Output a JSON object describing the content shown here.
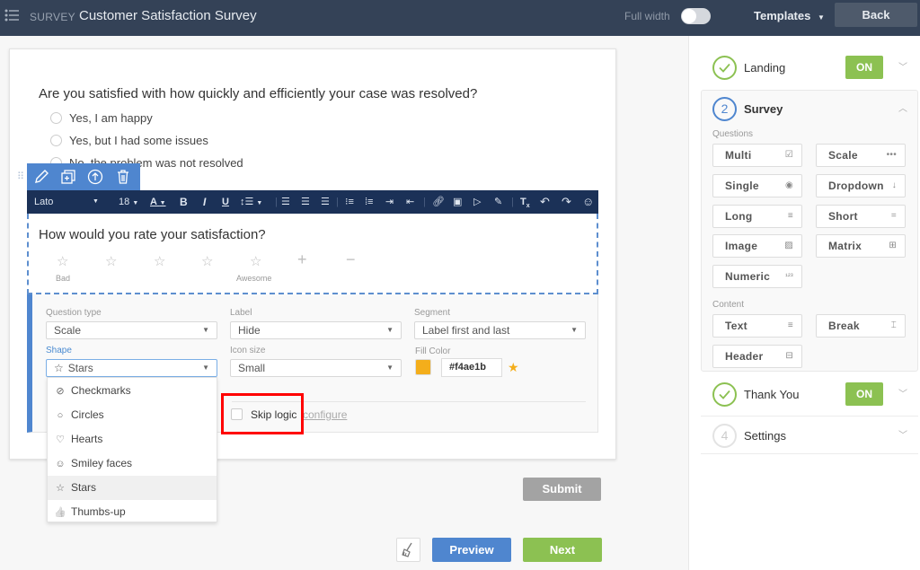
{
  "topbar": {
    "menu_icon": "list-menu-icon",
    "section": "SURVEY",
    "title": "Customer Satisfaction Survey",
    "full_width_label": "Full width",
    "full_width_on": false,
    "templates_label": "Templates",
    "back_label": "Back"
  },
  "question1": {
    "text": "Are you satisfied with how quickly and efficiently your case was resolved?",
    "options": [
      "Yes, I am happy",
      "Yes, but I had some issues",
      "No, the problem was not resolved"
    ]
  },
  "block_tools": [
    "edit-icon",
    "duplicate-icon",
    "move-up-icon",
    "delete-icon"
  ],
  "rich_text_toolbar": {
    "font": "Lato",
    "size": "18",
    "buttons": [
      "font-color",
      "bold",
      "italic",
      "underline",
      "line-height",
      "align-left",
      "align-center",
      "align-right",
      "bullet-list",
      "numbered-list",
      "indent",
      "outdent",
      "link",
      "image",
      "video",
      "clear-format-brush",
      "remove-format",
      "undo",
      "redo",
      "emoji"
    ]
  },
  "question2": {
    "text": "How would you rate your satisfaction?",
    "scale_count": 5,
    "label_first": "Bad",
    "label_last": "Awesome",
    "add_symbol": "+",
    "remove_symbol": "−"
  },
  "settings": {
    "question_type": {
      "label": "Question type",
      "value": "Scale"
    },
    "label": {
      "label": "Label",
      "value": "Hide"
    },
    "segment": {
      "label": "Segment",
      "value": "Label first and last"
    },
    "shape": {
      "label": "Shape",
      "value": "Stars",
      "icon": "☆"
    },
    "icon_size": {
      "label": "Icon size",
      "value": "Small"
    },
    "fill_color": {
      "label": "Fill Color",
      "value": "#f4ae1b"
    },
    "skip_logic": {
      "label": "Skip logic",
      "checked": false,
      "configure_label": "configure"
    }
  },
  "shape_dropdown": {
    "options": [
      {
        "label": "Checkmarks",
        "icon": "⊘"
      },
      {
        "label": "Circles",
        "icon": "○"
      },
      {
        "label": "Hearts",
        "icon": "♡"
      },
      {
        "label": "Smiley faces",
        "icon": "☺"
      },
      {
        "label": "Stars",
        "icon": "☆"
      },
      {
        "label": "Thumbs-up",
        "icon": "👍"
      }
    ],
    "selected": "Stars"
  },
  "footer": {
    "submit_label": "Submit",
    "preview_label": "Preview",
    "next_label": "Next"
  },
  "steps": {
    "landing": {
      "name": "Landing",
      "status": "ON"
    },
    "survey": {
      "number": "2",
      "name": "Survey"
    },
    "thank_you": {
      "name": "Thank You",
      "status": "ON"
    },
    "settings": {
      "number": "4",
      "name": "Settings"
    }
  },
  "palette": {
    "questions_label": "Questions",
    "questions": [
      {
        "label": "Multi",
        "icon": "☑"
      },
      {
        "label": "Scale",
        "icon": "•••"
      },
      {
        "label": "Single",
        "icon": "◉"
      },
      {
        "label": "Dropdown",
        "icon": "↓"
      },
      {
        "label": "Long",
        "icon": "≡"
      },
      {
        "label": "Short",
        "icon": "="
      },
      {
        "label": "Image",
        "icon": "▨"
      },
      {
        "label": "Matrix",
        "icon": "⊞"
      },
      {
        "label": "Numeric",
        "icon": "¹²³"
      }
    ],
    "content_label": "Content",
    "content": [
      {
        "label": "Text",
        "icon": "≡"
      },
      {
        "label": "Break",
        "icon": "⌶"
      },
      {
        "label": "Header",
        "icon": "⊟"
      }
    ]
  },
  "colors": {
    "topbar": "#344257",
    "accent_blue": "#4f86cf",
    "accent_green": "#8cc152",
    "toolbar_navy": "#1b3157",
    "fill": "#f4ae1b"
  }
}
